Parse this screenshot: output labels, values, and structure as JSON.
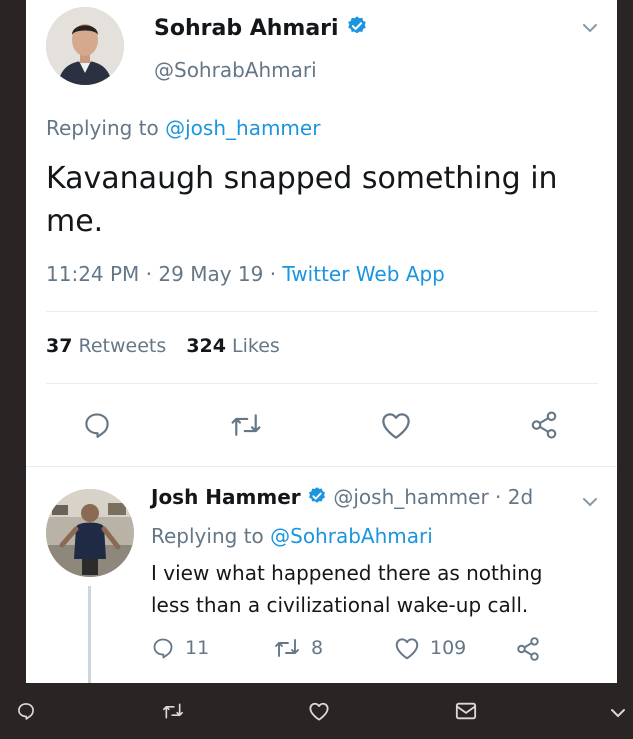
{
  "main_tweet": {
    "author_name": "Sohrab Ahmari",
    "author_handle": "@SohrabAhmari",
    "replying_prefix": "Replying to",
    "replying_handle": "@josh_hammer",
    "text_line1": "Kavanaugh snapped something in",
    "text_line2": "me.",
    "time_date": "11:24 PM · 29 May 19 · ",
    "source": "Twitter Web App",
    "retweets_count": "37",
    "retweets_label": "Retweets",
    "likes_count": "324",
    "likes_label": "Likes"
  },
  "reply_tweet": {
    "author_name": "Josh Hammer",
    "author_handle": "@josh_hammer",
    "age": "· 2d",
    "replying_prefix": "Replying to",
    "replying_handle": "@SohrabAhmari",
    "text_line1": "I view what happened there as nothing",
    "text_line2": "less than a civilizational wake-up call.",
    "reply_count": "11",
    "retweet_count": "8",
    "like_count": "109"
  },
  "colors": {
    "accent": "#1b95e0",
    "text_primary": "#14171a",
    "text_secondary": "#657786",
    "divider": "#e6ecf0",
    "background_dark": "#2a2424"
  },
  "icons": [
    "verified-badge-icon",
    "chevron-down-icon",
    "reply-icon",
    "retweet-icon",
    "like-icon",
    "share-icon",
    "message-icon"
  ]
}
